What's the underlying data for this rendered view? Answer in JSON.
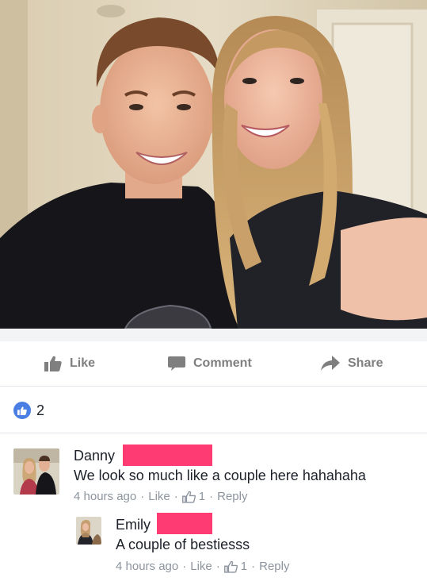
{
  "photo": {
    "alt": ""
  },
  "actions": {
    "like_label": "Like",
    "comment_label": "Comment",
    "share_label": "Share"
  },
  "reactions": {
    "icon": "thumbs-up-icon",
    "count": "2"
  },
  "comments": [
    {
      "name": "Danny",
      "text": "We look so much like a couple here hahahaha",
      "time": "4 hours ago",
      "like_label": "Like",
      "like_count": "1",
      "reply_label": "Reply"
    },
    {
      "name": "Emily",
      "text": "A couple of bestiesss",
      "time": "4 hours ago",
      "like_label": "Like",
      "like_count": "1",
      "reply_label": "Reply"
    }
  ],
  "colors": {
    "action_gray": "#7f7f7f",
    "meta_gray": "#8d949e",
    "like_blue": "#4a7ee3",
    "redaction_pink": "#ff3b73"
  }
}
